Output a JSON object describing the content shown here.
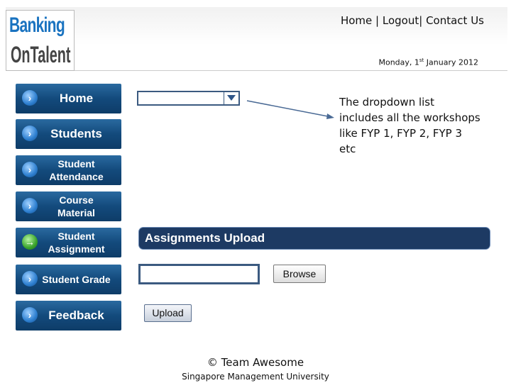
{
  "header": {
    "logo_text": [
      "Banking",
      "OnTalent"
    ],
    "links": [
      "Home",
      "Logout",
      "Contact Us"
    ],
    "separator": "|",
    "date": "Monday, 1st January 2012"
  },
  "sidebar": {
    "items": [
      {
        "label": "Home",
        "icon": "arrow-right-icon"
      },
      {
        "label": "Students",
        "icon": "arrow-right-icon"
      },
      {
        "label": "Student Attendance",
        "icon": "arrow-right-icon"
      },
      {
        "label": "Course Material",
        "icon": "arrow-right-icon"
      },
      {
        "label": "Student Assignment",
        "icon": "arrow-right-green-icon",
        "active": true
      },
      {
        "label": "Student Grade",
        "icon": "arrow-right-icon"
      },
      {
        "label": "Feedback",
        "icon": "arrow-right-icon"
      }
    ]
  },
  "main": {
    "dropdown_value": "",
    "annotation": "The dropdown list includes all the workshops like FYP 1, FYP 2, FYP 3 etc",
    "section_title": "Assignments Upload",
    "file_value": "",
    "browse_label": "Browse",
    "upload_label": "Upload"
  },
  "footer": {
    "copyright": "© Team Awesome",
    "org": "Singapore Management University"
  },
  "colors": {
    "nav": "#134a7c",
    "section": "#1d3a63"
  }
}
